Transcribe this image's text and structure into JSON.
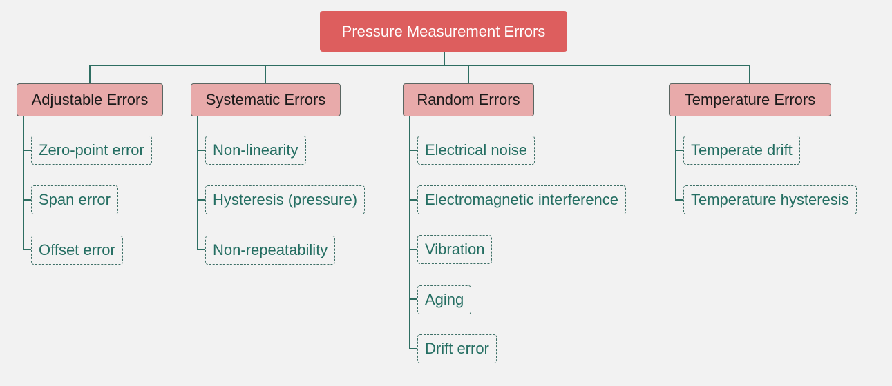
{
  "title": "Pressure Measurement Errors",
  "colors": {
    "root_fill": "#dd5e5e",
    "category_fill": "#e8aaaa",
    "connector": "#2e6e62",
    "leaf_text": "#246e62",
    "background": "#f2f2f2"
  },
  "categories": [
    {
      "label": "Adjustable Errors",
      "items": [
        "Zero-point error",
        "Span error",
        "Offset error"
      ]
    },
    {
      "label": "Systematic Errors",
      "items": [
        "Non-linearity",
        "Hysteresis (pressure)",
        "Non-repeatability"
      ]
    },
    {
      "label": "Random Errors",
      "items": [
        "Electrical noise",
        "Electromagnetic interference",
        "Vibration",
        "Aging",
        "Drift error"
      ]
    },
    {
      "label": "Temperature Errors",
      "items": [
        "Temperate drift",
        "Temperature hysteresis"
      ]
    }
  ]
}
